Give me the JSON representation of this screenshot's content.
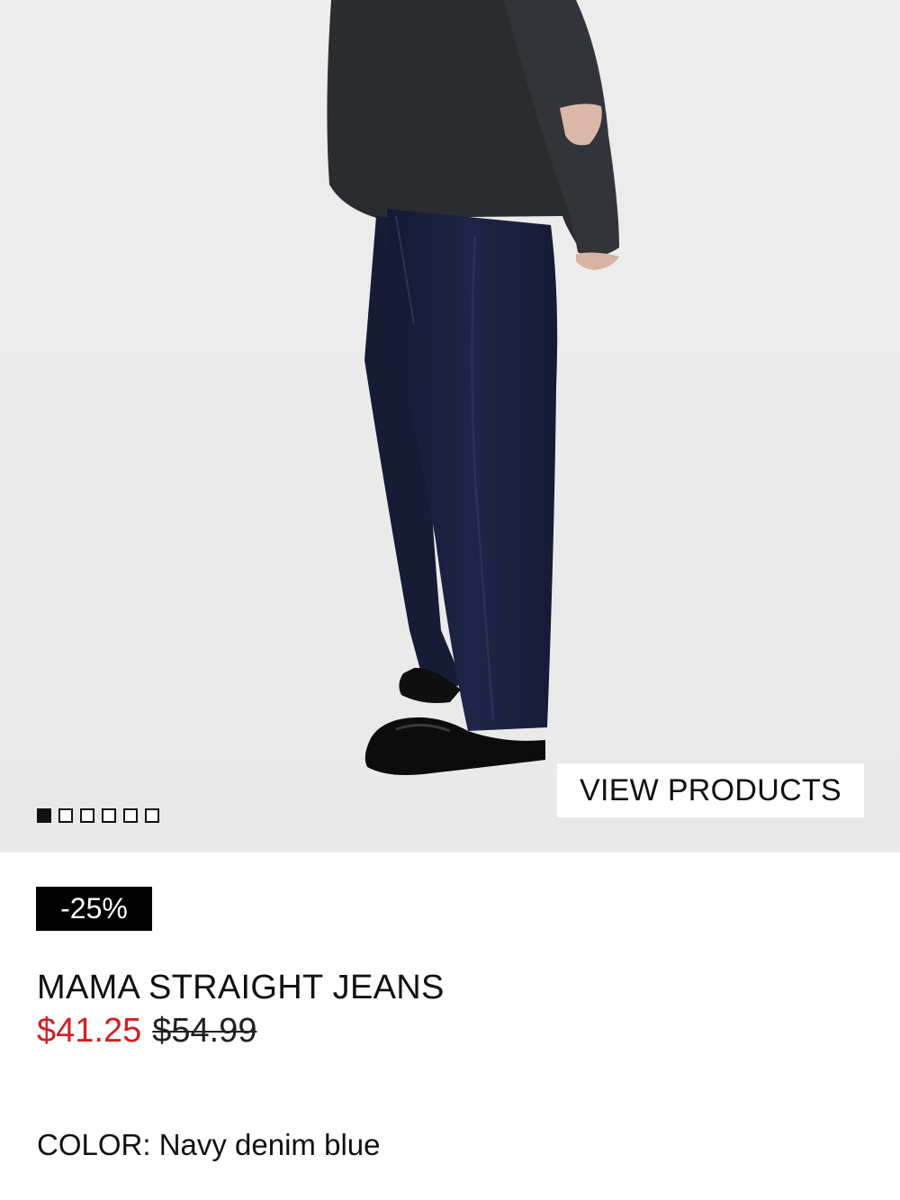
{
  "gallery": {
    "image_alt": "Model wearing navy denim straight jeans with black loafers",
    "slide_count": 6,
    "active_slide": 0,
    "view_button_label": "VIEW PRODUCTS"
  },
  "product": {
    "discount_badge": "-25%",
    "name": "MAMA STRAIGHT JEANS",
    "price_sale": "$41.25",
    "price_original": "$54.99",
    "color_label": "COLOR: Navy denim blue"
  },
  "colors": {
    "sale_price": "#d21f1f",
    "badge_bg": "#000000",
    "hero_bg": "#ebebeb",
    "denim": "#1c2240",
    "sweater": "#2b2c2f"
  }
}
